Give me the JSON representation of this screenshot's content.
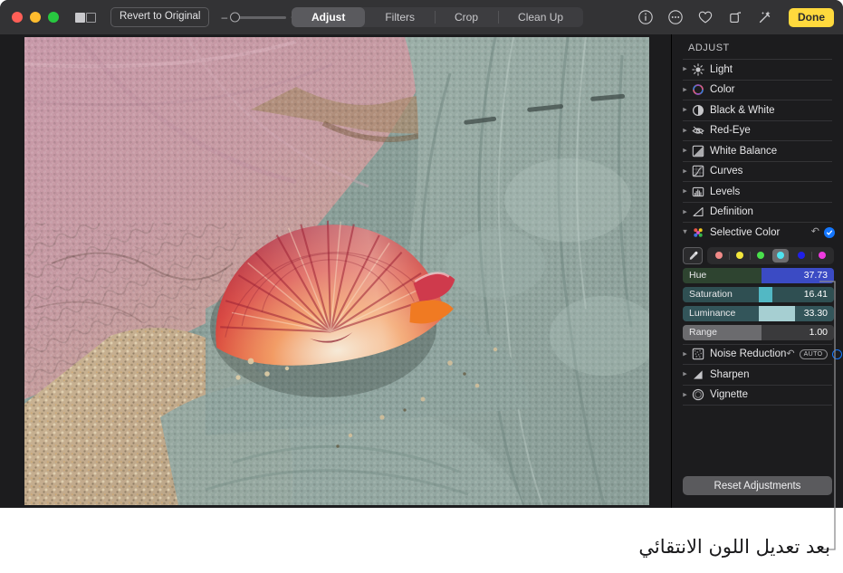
{
  "toolbar": {
    "traffic_lights": [
      "close",
      "minimize",
      "zoom"
    ],
    "split_view_label": "split-view",
    "revert_label": "Revert to Original",
    "zoom_minus": "–",
    "zoom_plus": "+",
    "zoom_level": 0,
    "tabs": [
      {
        "label": "Adjust",
        "active": true
      },
      {
        "label": "Filters",
        "active": false
      },
      {
        "label": "Crop",
        "active": false
      },
      {
        "label": "Clean Up",
        "active": false
      }
    ],
    "icons": [
      "info-icon",
      "more-options-icon",
      "favorite-icon",
      "rotate-icon",
      "auto-enhance-icon"
    ],
    "done_label": "Done",
    "done_color": "#ffd93d"
  },
  "sidebar": {
    "title": "ADJUST",
    "items": [
      {
        "label": "Light",
        "icon": "brightness-icon",
        "expanded": false
      },
      {
        "label": "Color",
        "icon": "color-wheel-icon",
        "expanded": false
      },
      {
        "label": "Black & White",
        "icon": "contrast-icon",
        "expanded": false
      },
      {
        "label": "Red-Eye",
        "icon": "eye-slash-icon",
        "expanded": false
      },
      {
        "label": "White Balance",
        "icon": "white-balance-icon",
        "expanded": false
      },
      {
        "label": "Curves",
        "icon": "curves-icon",
        "expanded": false
      },
      {
        "label": "Levels",
        "icon": "levels-icon",
        "expanded": false
      },
      {
        "label": "Definition",
        "icon": "definition-icon",
        "expanded": false
      }
    ],
    "selective_color": {
      "label": "Selective Color",
      "icon": "selective-color-icon",
      "expanded": true,
      "reset_icon": "reset-arrow-icon",
      "enabled_icon": "checkmark-icon",
      "eyedropper_icon": "eyedropper-icon",
      "swatches": [
        {
          "name": "red",
          "color": "#f08a88",
          "selected": false
        },
        {
          "name": "yellow",
          "color": "#f4e73c",
          "selected": false
        },
        {
          "name": "green",
          "color": "#49e04b",
          "selected": false
        },
        {
          "name": "cyan",
          "color": "#4fe4f0",
          "selected": true
        },
        {
          "name": "blue",
          "color": "#2020e8",
          "selected": false
        },
        {
          "name": "magenta",
          "color": "#ee3ae0",
          "selected": false
        }
      ],
      "sliders": [
        {
          "name": "Hue",
          "value": "37.73",
          "fill_pct": 52,
          "base_color": "#2e4430",
          "fill_color": "#3b4bc4",
          "fill_side": "right"
        },
        {
          "name": "Saturation",
          "value": "16.41",
          "fill_pct": 50,
          "fill_width": 9,
          "base_color": "#2f4f52",
          "fill_color": "#52b8c4",
          "fill_side": "mid"
        },
        {
          "name": "Luminance",
          "value": "33.30",
          "fill_pct": 50,
          "fill_width": 24,
          "base_color": "#33555a",
          "fill_color": "#a6cfd2",
          "fill_side": "mid"
        },
        {
          "name": "Range",
          "value": "1.00",
          "fill_pct": 52,
          "base_color": "#3a3a3c",
          "fill_color": "#6b6b6e",
          "fill_side": "left"
        }
      ]
    },
    "lower_items": [
      {
        "label": "Noise Reduction",
        "icon": "noise-reduction-icon",
        "expanded": false,
        "reset_icon": "reset-arrow-icon",
        "auto_badge": "AUTO",
        "toggle": "circle-toggle"
      },
      {
        "label": "Sharpen",
        "icon": "sharpen-icon",
        "expanded": false
      },
      {
        "label": "Vignette",
        "icon": "vignette-icon",
        "expanded": false
      }
    ],
    "reset_button_label": "Reset Adjustments"
  },
  "photo": {
    "alt": "Close-up of an orange and pink scallop shell resting on a sage-green terry towel beside sand and a pink coral-patterned cloth",
    "accent_shell": "#d6453f",
    "accent_towel": "#8ca29b",
    "accent_cloth": "#c59ba7"
  },
  "caption": {
    "text": "بعد تعديل اللون الانتقائي"
  }
}
